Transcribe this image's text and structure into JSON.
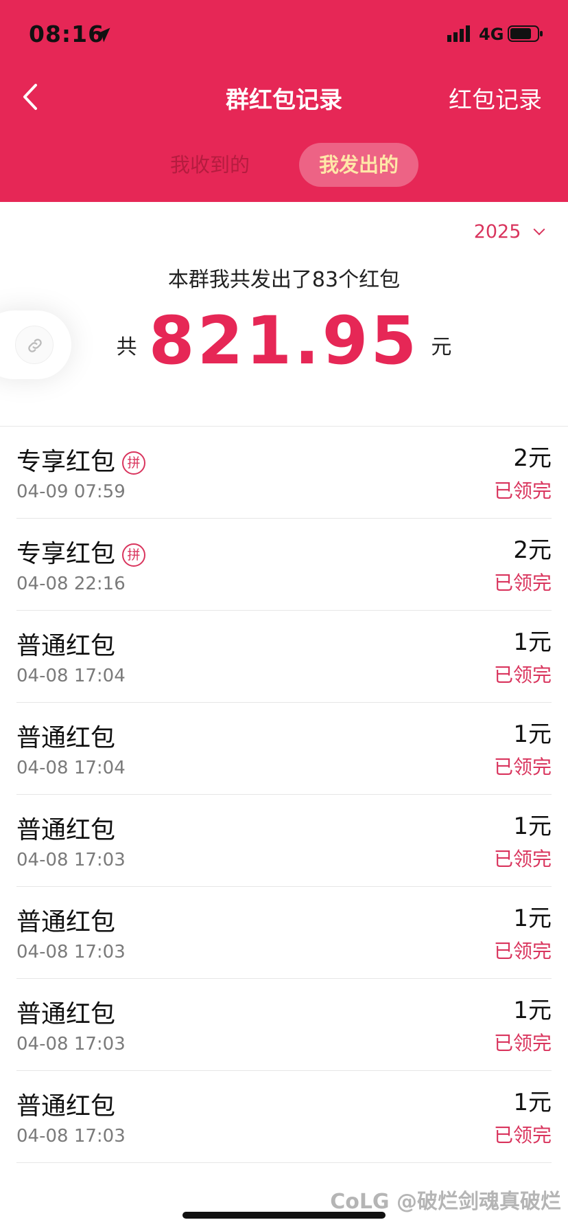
{
  "status_bar": {
    "time": "08:16",
    "network": "4G"
  },
  "nav": {
    "title": "群红包记录",
    "right_action": "红包记录"
  },
  "tabs": [
    {
      "label": "我收到的",
      "active": false
    },
    {
      "label": "我发出的",
      "active": true
    }
  ],
  "summary": {
    "year": "2025",
    "sent_text": "本群我共发出了83个红包",
    "total_prefix": "共",
    "total_amount": "821.95",
    "total_suffix": "元"
  },
  "records": [
    {
      "name": "专享红包",
      "badge": "拼",
      "time": "04-09 07:59",
      "amount": "2元",
      "status": "已领完"
    },
    {
      "name": "专享红包",
      "badge": "拼",
      "time": "04-08 22:16",
      "amount": "2元",
      "status": "已领完"
    },
    {
      "name": "普通红包",
      "badge": "",
      "time": "04-08 17:04",
      "amount": "1元",
      "status": "已领完"
    },
    {
      "name": "普通红包",
      "badge": "",
      "time": "04-08 17:04",
      "amount": "1元",
      "status": "已领完"
    },
    {
      "name": "普通红包",
      "badge": "",
      "time": "04-08 17:03",
      "amount": "1元",
      "status": "已领完"
    },
    {
      "name": "普通红包",
      "badge": "",
      "time": "04-08 17:03",
      "amount": "1元",
      "status": "已领完"
    },
    {
      "name": "普通红包",
      "badge": "",
      "time": "04-08 17:03",
      "amount": "1元",
      "status": "已领完"
    },
    {
      "name": "普通红包",
      "badge": "",
      "time": "04-08 17:03",
      "amount": "1元",
      "status": "已领完"
    }
  ],
  "watermark": "CoLG @破烂剑魂真破烂",
  "colors": {
    "brand_red": "#e62756",
    "status_red": "#d9345d",
    "active_tab_text": "#ffe7a8"
  },
  "icons": {
    "back": "back-icon",
    "location": "location-arrow-icon",
    "signal": "signal-icon",
    "battery": "battery-icon",
    "link": "link-icon",
    "year_dropdown": "chevron-down-icon"
  }
}
